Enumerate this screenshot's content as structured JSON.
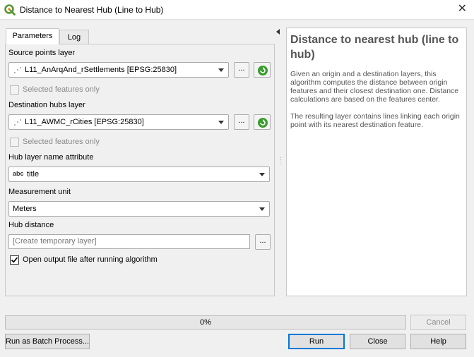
{
  "window": {
    "title": "Distance to Nearest Hub (Line to Hub)",
    "close_glyph": "✕"
  },
  "tabs": [
    {
      "label": "Parameters",
      "active": true
    },
    {
      "label": "Log",
      "active": false
    }
  ],
  "params": {
    "source_label": "Source points layer",
    "source_value": "L11_AnArqAnd_rSettlements [EPSG:25830]",
    "source_selected_only": "Selected features only",
    "dest_label": "Destination hubs layer",
    "dest_value": "L11_AWMC_rCities [EPSG:25830]",
    "dest_selected_only": "Selected features only",
    "hub_attr_label": "Hub layer name attribute",
    "hub_attr_type": "abc",
    "hub_attr_value": "title",
    "unit_label": "Measurement unit",
    "unit_value": "Meters",
    "hub_distance_label": "Hub distance",
    "hub_distance_placeholder": "[Create temporary layer]",
    "open_output_label": "Open output file after running algorithm",
    "open_output_checked": true,
    "browse_label": "..."
  },
  "help": {
    "title": "Distance to nearest hub (line to hub)",
    "paragraph1": "Given an origin and a destination layers, this algorithm computes the distance between origin features and their closest destination one. Distance calculations are based on the features center.",
    "paragraph2": "The resulting layer contains lines linking each origin point with its nearest destination feature."
  },
  "footer": {
    "progress_text": "0%",
    "progress_value": 0,
    "cancel_label": "Cancel",
    "batch_label": "Run as Batch Process...",
    "run_label": "Run",
    "close_label": "Close",
    "help_label": "Help"
  },
  "colors": {
    "qgis_green": "#589632",
    "qgis_yellow": "#ee7913",
    "accent_blue": "#0078d7",
    "refresh_green": "#3a9c2e"
  }
}
